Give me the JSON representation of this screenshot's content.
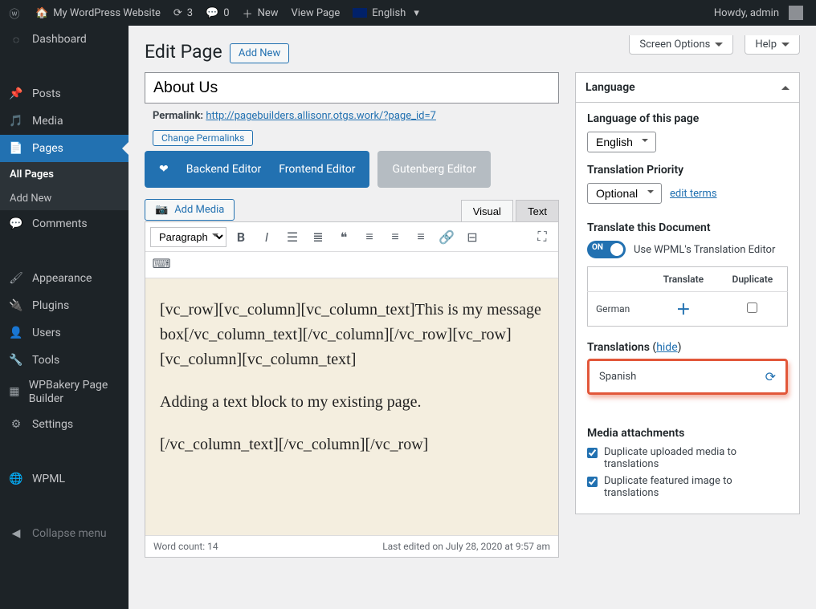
{
  "adminbar": {
    "site_title": "My WordPress Website",
    "updates": "3",
    "comments": "0",
    "new_label": "New",
    "view_page": "View Page",
    "language": "English",
    "howdy": "Howdy, admin"
  },
  "menu": {
    "dashboard": "Dashboard",
    "posts": "Posts",
    "media": "Media",
    "pages": "Pages",
    "all_pages": "All Pages",
    "add_new": "Add New",
    "comments": "Comments",
    "appearance": "Appearance",
    "plugins": "Plugins",
    "users": "Users",
    "tools": "Tools",
    "wpbakery": "WPBakery Page Builder",
    "settings": "Settings",
    "wpml": "WPML",
    "collapse": "Collapse menu"
  },
  "screen": {
    "options": "Screen Options",
    "help": "Help"
  },
  "heading": {
    "edit_page": "Edit Page",
    "add_new": "Add New"
  },
  "title": {
    "value": "About Us"
  },
  "permalink": {
    "label": "Permalink:",
    "url": "http://pagebuilders.allisonr.otgs.work/?page_id=7",
    "change_btn": "Change Permalinks"
  },
  "editor_tabs": {
    "backend": "Backend Editor",
    "frontend": "Frontend Editor",
    "gutenberg": "Gutenberg Editor"
  },
  "media_btn": "Add Media",
  "editor_switch": {
    "visual": "Visual",
    "text": "Text"
  },
  "format_select": "Paragraph",
  "content": {
    "p1": "[vc_row][vc_column][vc_column_text]This is my message box[/vc_column_text][/vc_column][/vc_row][vc_row][vc_column][vc_column_text]",
    "p2": "Adding a text block to my existing page.",
    "p3": "[/vc_column_text][/vc_column][/vc_row]"
  },
  "status": {
    "wordcount": "Word count: 14",
    "lastedit": "Last edited on July 28, 2020 at 9:57 am"
  },
  "langbox": {
    "title": "Language",
    "lang_of_page": "Language of this page",
    "lang_select": "English",
    "priority_label": "Translation Priority",
    "priority_select": "Optional",
    "edit_terms": "edit terms",
    "translate_doc": "Translate this Document",
    "toggle_on": "ON",
    "toggle_label": "Use WPML's Translation Editor",
    "th_translate": "Translate",
    "th_duplicate": "Duplicate",
    "row_german": "German",
    "translations_label": "Translations",
    "hide": "hide",
    "spanish": "Spanish",
    "media_heading": "Media attachments",
    "dup_uploaded": "Duplicate uploaded media to translations",
    "dup_featured": "Duplicate featured image to translations"
  }
}
